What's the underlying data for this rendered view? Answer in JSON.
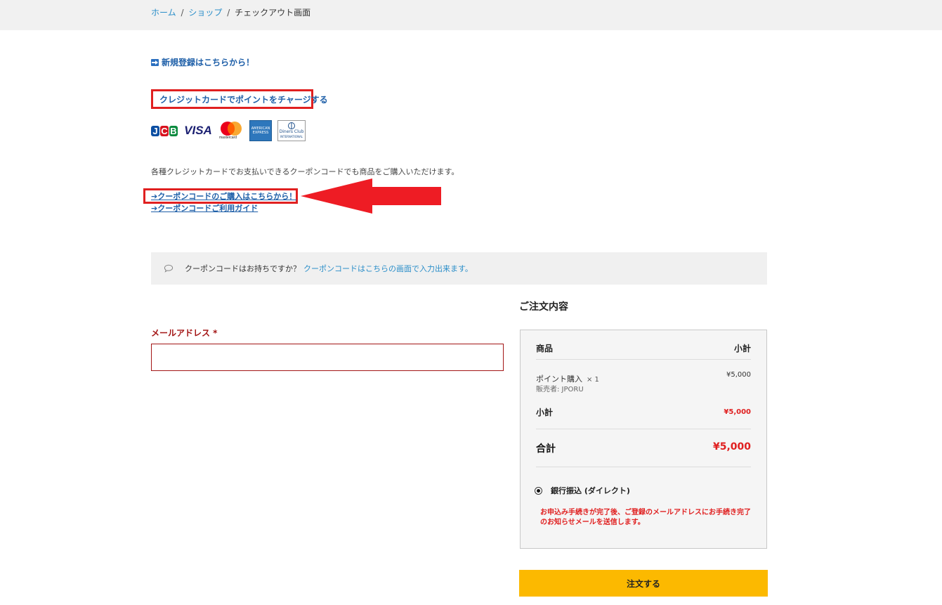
{
  "breadcrumb": {
    "home": "ホーム",
    "shop": "ショップ",
    "current": "チェックアウト画面",
    "separator": "/"
  },
  "register_link": "新規登録はこちらから！",
  "charge_link": "クレジットカードでポイントをチャージする",
  "cards": {
    "jcb_letters": [
      "J",
      "C",
      "B"
    ],
    "visa": "VISA",
    "mastercard": "mastercard",
    "amex": "AMERICAN EXPRESS",
    "diners": [
      "Diners Club",
      "INTERNATIONAL"
    ]
  },
  "description": "各種クレジットカードでお支払いできるクーポンコードでも商品をご購入いただけます。",
  "coupon_purchase_link": "➔クーポンコードのご購入はこちらから！",
  "coupon_guide_link": "➔クーポンコードご利用ガイド",
  "coupon_banner": {
    "text": "クーポンコードはお持ちですか？",
    "link": "クーポンコードはこちらの画面で入力出来ます。"
  },
  "email": {
    "label": "メールアドレス *",
    "value": "",
    "placeholder": ""
  },
  "order": {
    "title": "ご注文内容",
    "header_product": "商品",
    "header_subtotal": "小計",
    "item_name": "ポイント購入",
    "item_qty": "× 1",
    "seller": "販売者: JPORU",
    "item_price": "¥5,000",
    "subtotal_label": "小計",
    "subtotal_value": "¥5,000",
    "total_label": "合計",
    "total_value": "¥5,000",
    "payment_method": "銀行振込 (ダイレクト)",
    "payment_note": "お申込み手続きが完了後、ご登録のメールアドレスにお手続き完了のお知らせメールを送信します。"
  },
  "order_button": "注文する",
  "colors": {
    "link": "#1e5fa8",
    "accent_red": "#e02020",
    "button": "#fcb900",
    "topbar": "#f1f1f1"
  }
}
